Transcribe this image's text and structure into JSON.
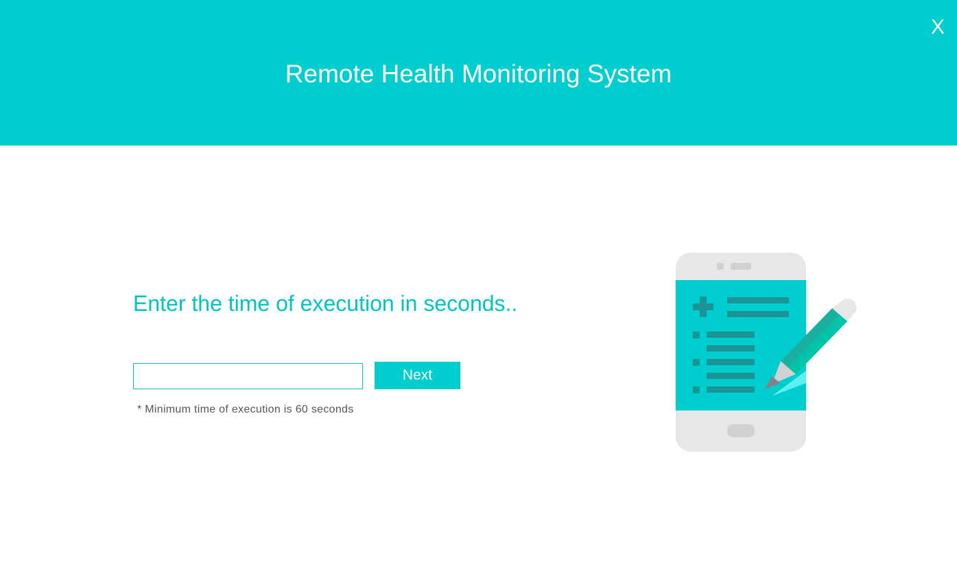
{
  "header": {
    "title": "Remote Health Monitoring System",
    "close_label": "X",
    "background_color": "#00cdcd"
  },
  "main": {
    "prompt": "Enter the time of execution in seconds..",
    "time_input": {
      "value": "",
      "placeholder": ""
    },
    "next_label": "Next",
    "hint": "* Minimum time of execution is 60 seconds"
  },
  "illustration": {
    "icon": "phone-medical-record-with-pencil-icon",
    "colors": {
      "phone_body": "#e6e7e8",
      "screen": "#00cdcd",
      "lines": "#1a9494",
      "pencil": "#00c4aa",
      "pencil_dark": "#1ab0a0"
    }
  }
}
